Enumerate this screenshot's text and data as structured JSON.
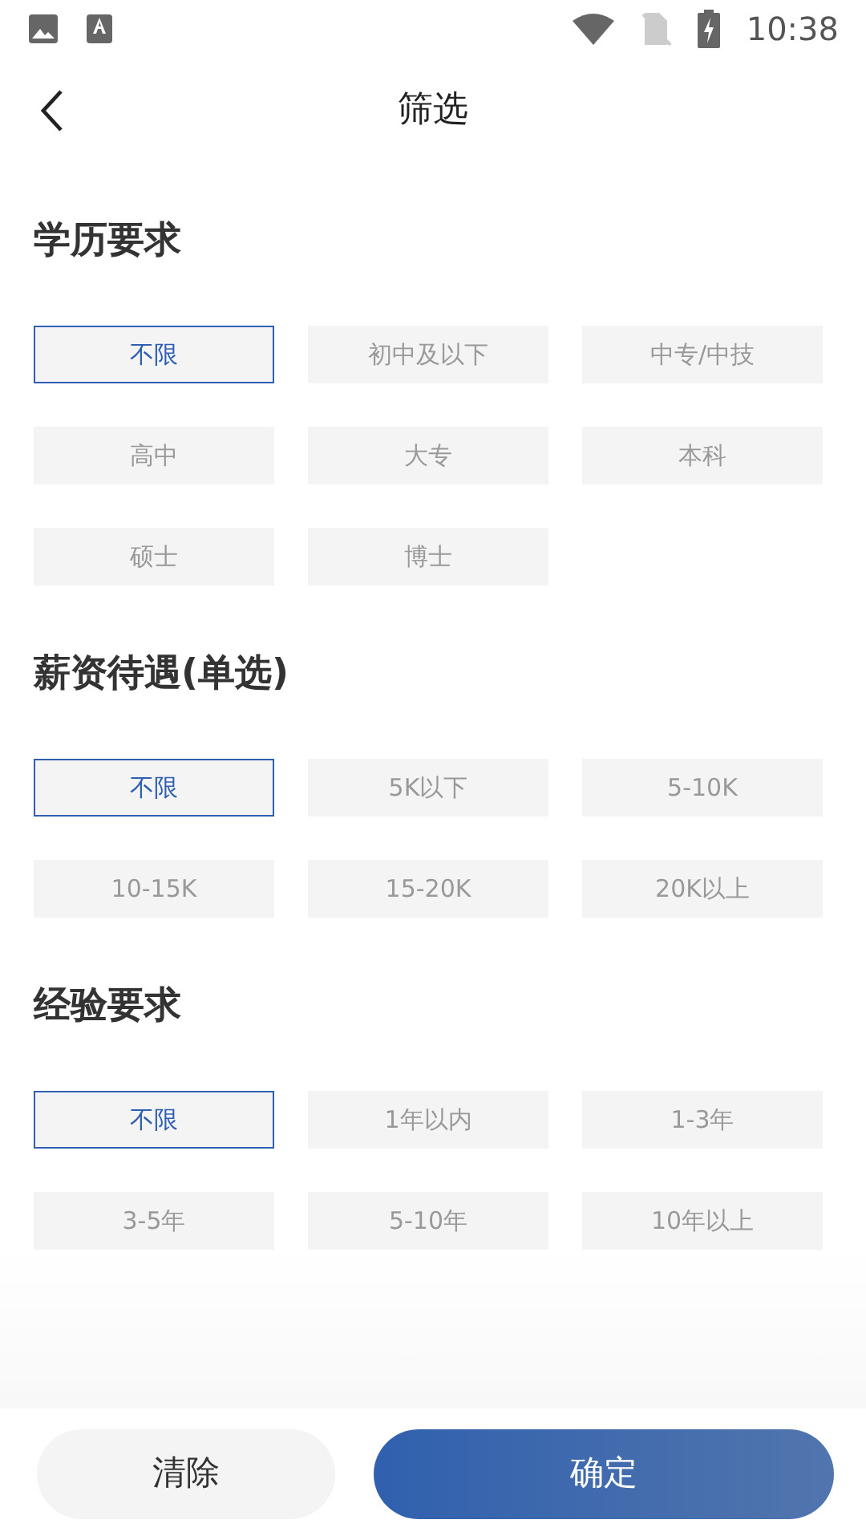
{
  "status_bar": {
    "time": "10:38"
  },
  "header": {
    "title": "筛选"
  },
  "sections": [
    {
      "title": "学历要求",
      "options": [
        {
          "label": "不限",
          "selected": true
        },
        {
          "label": "初中及以下",
          "selected": false
        },
        {
          "label": "中专/中技",
          "selected": false
        },
        {
          "label": "高中",
          "selected": false
        },
        {
          "label": "大专",
          "selected": false
        },
        {
          "label": "本科",
          "selected": false
        },
        {
          "label": "硕士",
          "selected": false
        },
        {
          "label": "博士",
          "selected": false
        }
      ]
    },
    {
      "title": "薪资待遇(单选)",
      "options": [
        {
          "label": "不限",
          "selected": true
        },
        {
          "label": "5K以下",
          "selected": false
        },
        {
          "label": "5-10K",
          "selected": false
        },
        {
          "label": "10-15K",
          "selected": false
        },
        {
          "label": "15-20K",
          "selected": false
        },
        {
          "label": "20K以上",
          "selected": false
        }
      ]
    },
    {
      "title": "经验要求",
      "options": [
        {
          "label": "不限",
          "selected": true
        },
        {
          "label": "1年以内",
          "selected": false
        },
        {
          "label": "1-3年",
          "selected": false
        },
        {
          "label": "3-5年",
          "selected": false
        },
        {
          "label": "5-10年",
          "selected": false
        },
        {
          "label": "10年以上",
          "selected": false
        }
      ]
    }
  ],
  "buttons": {
    "clear": "清除",
    "confirm": "确定"
  }
}
